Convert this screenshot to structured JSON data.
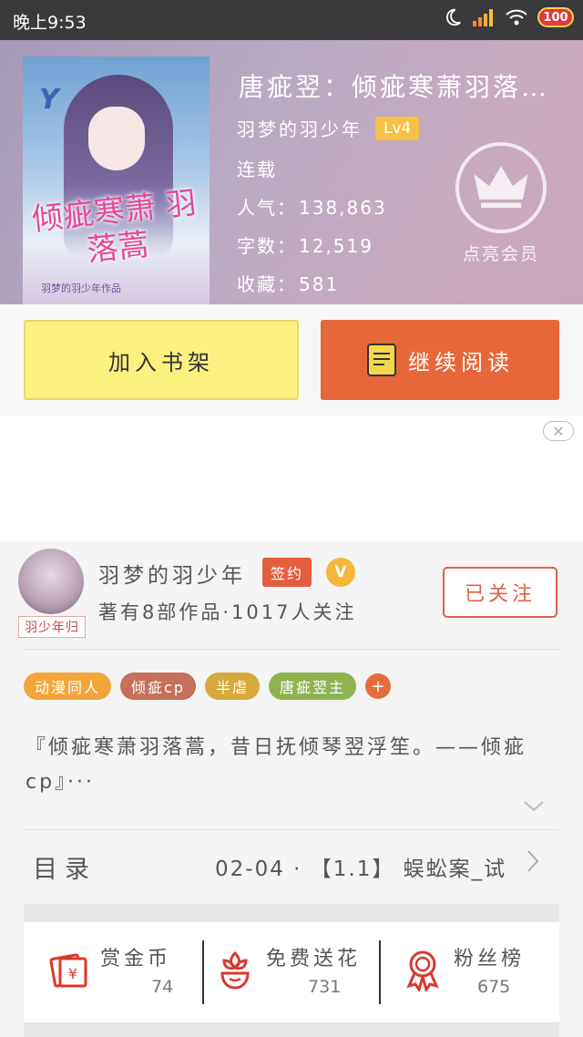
{
  "status_bar": {
    "time": "晚上9:53",
    "battery": "100"
  },
  "book": {
    "title": "唐疵翌：倾疵寒萧羽落…",
    "author": "羽梦的羽少年",
    "level": "Lv4",
    "status": "连载",
    "popularity_label": "人气：",
    "popularity": "138,863",
    "words_label": "字数：",
    "words": "12,519",
    "favorites_label": "收藏：",
    "favorites": "581",
    "cover_title": "倾疵寒萧 羽落蒿",
    "cover_author": "羽梦的羽少年作品",
    "cover_logo": "Y"
  },
  "vip": {
    "label": "点亮会员"
  },
  "actions": {
    "add_shelf": "加入书架",
    "continue_reading": "继续阅读"
  },
  "ad": {
    "close": "✕"
  },
  "author_card": {
    "name": "羽梦的羽少年",
    "avatar_tag": "羽少年归",
    "sign_badge": "签约",
    "v_badge": "V",
    "works": "著有8部作品·1017人关注",
    "follow": "已关注"
  },
  "tags": [
    {
      "label": "动漫同人",
      "color": "#f2a53a"
    },
    {
      "label": "倾疵cp",
      "color": "#c5705a"
    },
    {
      "label": "半虐",
      "color": "#d7a93a"
    },
    {
      "label": "唐疵翌主",
      "color": "#8fb351"
    }
  ],
  "tag_plus": "+",
  "description": "『倾疵寒萧羽落蒿，昔日抚倾琴翌浮笙。——倾疵cp』···",
  "toc": {
    "label": "目录",
    "latest": "02-04 · 【1.1】 蜈蚣案_试"
  },
  "stats": [
    {
      "label": "赏金币",
      "value": "74",
      "icon": "red-envelope-yen-icon"
    },
    {
      "label": "免费送花",
      "value": "731",
      "icon": "flower-pot-icon"
    },
    {
      "label": "粉丝榜",
      "value": "675",
      "icon": "ribbon-medal-icon"
    }
  ],
  "colors": {
    "accent": "#e6673a",
    "shelf": "#fbf180",
    "follow": "#e2604a"
  }
}
